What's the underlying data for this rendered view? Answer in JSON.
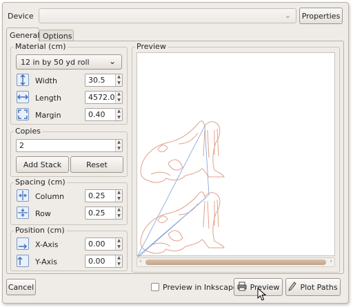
{
  "device": {
    "label": "Device",
    "value": "",
    "properties_label": "Properties"
  },
  "tabs": [
    {
      "label": "General",
      "active": true
    },
    {
      "label": "Options",
      "active": false
    }
  ],
  "material": {
    "title": "Material (cm)",
    "preset": "12 in by 50 yd roll",
    "width_label": "Width",
    "width_value": "30.5",
    "length_label": "Length",
    "length_value": "4572.0",
    "margin_label": "Margin",
    "margin_value": "0.40"
  },
  "copies": {
    "title": "Copies",
    "value": "2",
    "add_stack_label": "Add Stack",
    "reset_label": "Reset"
  },
  "spacing": {
    "title": "Spacing (cm)",
    "column_label": "Column",
    "column_value": "0.25",
    "row_label": "Row",
    "row_value": "0.25"
  },
  "position": {
    "title": "Position (cm)",
    "x_label": "X-Axis",
    "x_value": "0.00",
    "y_label": "Y-Axis",
    "y_value": "0.00"
  },
  "preview": {
    "title": "Preview"
  },
  "footer": {
    "cancel_label": "Cancel",
    "preview_inkscape_label": "Preview in Inkscape",
    "preview_inkscape_checked": false,
    "preview_button_label": "Preview",
    "plot_paths_label": "Plot Paths"
  },
  "colors": {
    "accent": "#3f6fb5",
    "path": "#e0a088",
    "preview_line": "#7aa0d6"
  }
}
